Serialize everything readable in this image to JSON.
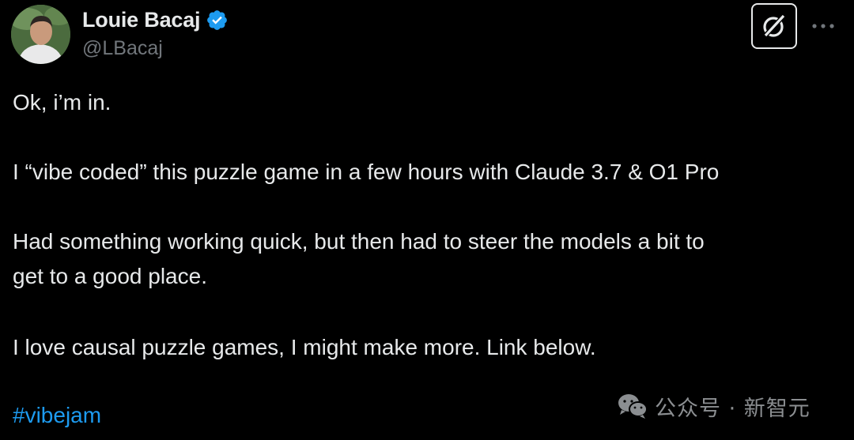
{
  "author": {
    "name": "Louie Bacaj",
    "handle": "@LBacaj",
    "verified": true
  },
  "tweet": {
    "paragraph_1": "Ok, i’m in.",
    "paragraph_2": "I “vibe coded” this puzzle game in a few hours with Claude 3.7 & O1 Pro",
    "paragraph_3_line_1": "Had something working quick, but then had to steer the models a bit to",
    "paragraph_3_line_2": "get to a good place.",
    "paragraph_4": "I love causal puzzle games, I might make more. Link below.",
    "hashtag": "#vibejam"
  },
  "watermark": {
    "text": "公众号 · 新智元"
  },
  "icons": {
    "verified": "verified-badge-icon",
    "grok": "grok-icon",
    "more": "more-options-icon",
    "wechat": "wechat-icon"
  },
  "colors": {
    "background": "#000000",
    "text": "#e7e9ea",
    "secondary_text": "#71767b",
    "link": "#1d9bf0",
    "verified": "#1d9bf0"
  }
}
